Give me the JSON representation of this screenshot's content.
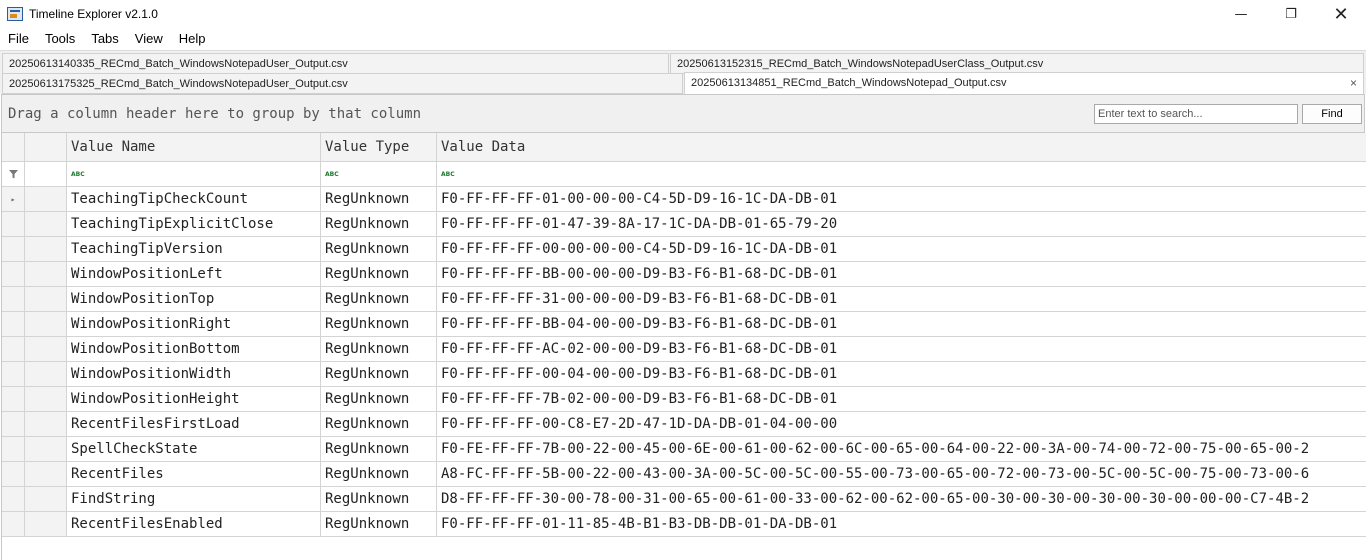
{
  "window": {
    "title": "Timeline Explorer v2.1.0",
    "minimize": "—",
    "maximize": "❐",
    "close": "✕"
  },
  "menu": [
    "File",
    "Tools",
    "Tabs",
    "View",
    "Help"
  ],
  "tabs": {
    "row1": [
      "20250613140335_RECmd_Batch_WindowsNotepadUser_Output.csv",
      "20250613152315_RECmd_Batch_WindowsNotepadUserClass_Output.csv"
    ],
    "row2": [
      "20250613175325_RECmd_Batch_WindowsNotepadUser_Output.csv",
      "20250613134851_RECmd_Batch_WindowsNotepad_Output.csv"
    ],
    "active_close": "×"
  },
  "group_panel": {
    "hint": "Drag a column header here to group by that column",
    "search_placeholder": "Enter text to search...",
    "find_label": "Find"
  },
  "grid": {
    "columns": [
      "Value Name",
      "Value Type",
      "Value Data"
    ],
    "filter_icon": "funnel-icon",
    "rows": [
      [
        "TeachingTipCheckCount",
        "RegUnknown",
        "F0-FF-FF-FF-01-00-00-00-C4-5D-D9-16-1C-DA-DB-01"
      ],
      [
        "TeachingTipExplicitClose",
        "RegUnknown",
        "F0-FF-FF-FF-01-47-39-8A-17-1C-DA-DB-01-65-79-20"
      ],
      [
        "TeachingTipVersion",
        "RegUnknown",
        "F0-FF-FF-FF-00-00-00-00-C4-5D-D9-16-1C-DA-DB-01"
      ],
      [
        "WindowPositionLeft",
        "RegUnknown",
        "F0-FF-FF-FF-BB-00-00-00-D9-B3-F6-B1-68-DC-DB-01"
      ],
      [
        "WindowPositionTop",
        "RegUnknown",
        "F0-FF-FF-FF-31-00-00-00-D9-B3-F6-B1-68-DC-DB-01"
      ],
      [
        "WindowPositionRight",
        "RegUnknown",
        "F0-FF-FF-FF-BB-04-00-00-D9-B3-F6-B1-68-DC-DB-01"
      ],
      [
        "WindowPositionBottom",
        "RegUnknown",
        "F0-FF-FF-FF-AC-02-00-00-D9-B3-F6-B1-68-DC-DB-01"
      ],
      [
        "WindowPositionWidth",
        "RegUnknown",
        "F0-FF-FF-FF-00-04-00-00-D9-B3-F6-B1-68-DC-DB-01"
      ],
      [
        "WindowPositionHeight",
        "RegUnknown",
        "F0-FF-FF-FF-7B-02-00-00-D9-B3-F6-B1-68-DC-DB-01"
      ],
      [
        "RecentFilesFirstLoad",
        "RegUnknown",
        "F0-FF-FF-FF-00-C8-E7-2D-47-1D-DA-DB-01-04-00-00"
      ],
      [
        "SpellCheckState",
        "RegUnknown",
        "F0-FE-FF-FF-7B-00-22-00-45-00-6E-00-61-00-62-00-6C-00-65-00-64-00-22-00-3A-00-74-00-72-00-75-00-65-00-2"
      ],
      [
        "RecentFiles",
        "RegUnknown",
        "A8-FC-FF-FF-5B-00-22-00-43-00-3A-00-5C-00-5C-00-55-00-73-00-65-00-72-00-73-00-5C-00-5C-00-75-00-73-00-6"
      ],
      [
        "FindString",
        "RegUnknown",
        "D8-FF-FF-FF-30-00-78-00-31-00-65-00-61-00-33-00-62-00-62-00-65-00-30-00-30-00-30-00-30-00-00-00-C7-4B-2"
      ],
      [
        "RecentFilesEnabled",
        "RegUnknown",
        "F0-FF-FF-FF-01-11-85-4B-B1-B3-DB-DB-01-DA-DB-01"
      ]
    ]
  }
}
